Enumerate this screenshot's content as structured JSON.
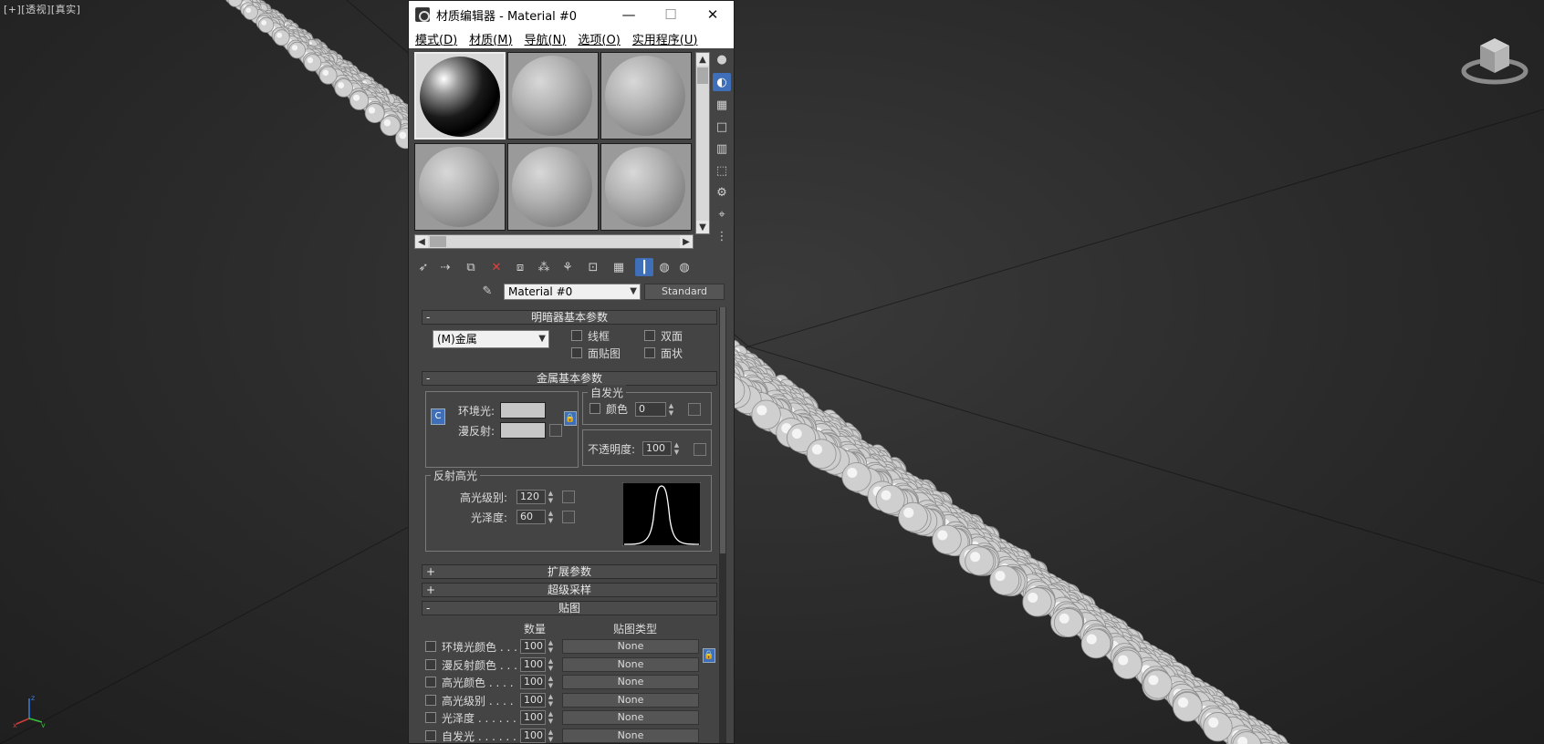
{
  "viewport": {
    "label": "[+][透视][真实]"
  },
  "window": {
    "title": "材质编辑器 - Material #0",
    "controls": {
      "minimize": "—",
      "maximize": "☐",
      "close": "✕"
    }
  },
  "menu": [
    {
      "label": "模式(D)"
    },
    {
      "label": "材质(M)"
    },
    {
      "label": "导航(N)"
    },
    {
      "label": "选项(O)"
    },
    {
      "label": "实用程序(U)"
    }
  ],
  "material": {
    "name": "Material #0",
    "type": "Standard"
  },
  "shader_basic": {
    "header": "明暗器基本参数",
    "shader": "(M)金属",
    "wire": "线框",
    "two_sided": "双面",
    "face_map": "面贴图",
    "faceted": "面状"
  },
  "metal_basic": {
    "header": "金属基本参数",
    "ambient_label": "环境光:",
    "diffuse_label": "漫反射:",
    "self_illum_title": "自发光",
    "color_label": "颜色",
    "color_value": "0",
    "opacity_label": "不透明度:",
    "opacity_value": "100",
    "specular_title": "反射高光",
    "spec_level_label": "高光级别:",
    "spec_level_value": "120",
    "gloss_label": "光泽度:",
    "gloss_value": "60",
    "colors": {
      "ambient": "#c7c7c7",
      "diffuse": "#c7c7c7"
    }
  },
  "rollouts_collapsed": [
    {
      "sign": "+",
      "label": "扩展参数"
    },
    {
      "sign": "+",
      "label": "超级采样"
    }
  ],
  "maps": {
    "header": "贴图",
    "amount_header": "数量",
    "map_type_header": "贴图类型",
    "rows": [
      {
        "label": "环境光颜色 . . .",
        "amount": "100",
        "map": "None"
      },
      {
        "label": "漫反射颜色 . . .",
        "amount": "100",
        "map": "None"
      },
      {
        "label": "高光颜色 . . . .",
        "amount": "100",
        "map": "None"
      },
      {
        "label": "高光级别 . . . .",
        "amount": "100",
        "map": "None"
      },
      {
        "label": "光泽度 . . . . . .",
        "amount": "100",
        "map": "None"
      },
      {
        "label": "自发光 . . . . . .",
        "amount": "100",
        "map": "None"
      }
    ]
  },
  "gizmo": {
    "x": "x",
    "y": "y",
    "z": "z"
  }
}
